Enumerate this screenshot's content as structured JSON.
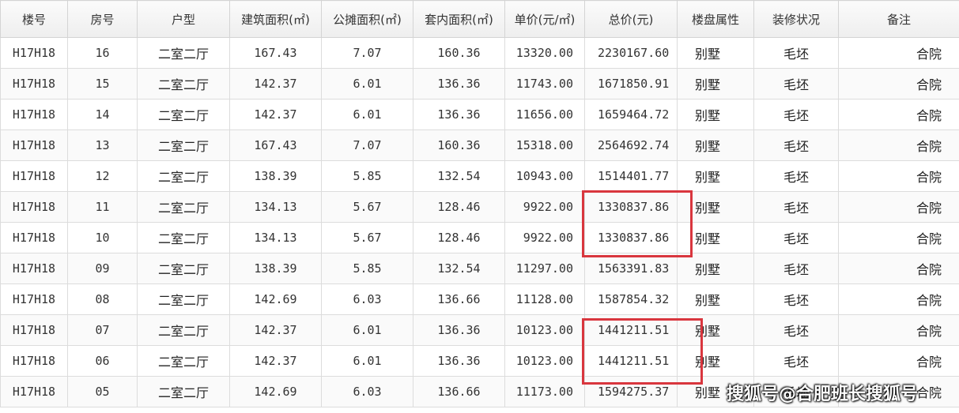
{
  "table": {
    "headers": [
      "楼号",
      "房号",
      "户型",
      "建筑面积(㎡)",
      "公摊面积(㎡)",
      "套内面积(㎡)",
      "单价(元/㎡)",
      "总价(元)",
      "楼盘属性",
      "装修状况",
      "备注"
    ],
    "rows": [
      {
        "building": "H17H18",
        "room": "16",
        "layout": "二室二厅",
        "gross_area": "167.43",
        "shared_area": "7.07",
        "inner_area": "160.36",
        "unit_price": "13320.00",
        "total_price": "2230167.60",
        "property_type": "别墅",
        "decoration": "毛坯",
        "note": "合院"
      },
      {
        "building": "H17H18",
        "room": "15",
        "layout": "二室二厅",
        "gross_area": "142.37",
        "shared_area": "6.01",
        "inner_area": "136.36",
        "unit_price": "11743.00",
        "total_price": "1671850.91",
        "property_type": "别墅",
        "decoration": "毛坯",
        "note": "合院"
      },
      {
        "building": "H17H18",
        "room": "14",
        "layout": "二室二厅",
        "gross_area": "142.37",
        "shared_area": "6.01",
        "inner_area": "136.36",
        "unit_price": "11656.00",
        "total_price": "1659464.72",
        "property_type": "别墅",
        "decoration": "毛坯",
        "note": "合院"
      },
      {
        "building": "H17H18",
        "room": "13",
        "layout": "二室二厅",
        "gross_area": "167.43",
        "shared_area": "7.07",
        "inner_area": "160.36",
        "unit_price": "15318.00",
        "total_price": "2564692.74",
        "property_type": "别墅",
        "decoration": "毛坯",
        "note": "合院"
      },
      {
        "building": "H17H18",
        "room": "12",
        "layout": "二室二厅",
        "gross_area": "138.39",
        "shared_area": "5.85",
        "inner_area": "132.54",
        "unit_price": "10943.00",
        "total_price": "1514401.77",
        "property_type": "别墅",
        "decoration": "毛坯",
        "note": "合院"
      },
      {
        "building": "H17H18",
        "room": "11",
        "layout": "二室二厅",
        "gross_area": "134.13",
        "shared_area": "5.67",
        "inner_area": "128.46",
        "unit_price": "9922.00",
        "total_price": "1330837.86",
        "property_type": "别墅",
        "decoration": "毛坯",
        "note": "合院"
      },
      {
        "building": "H17H18",
        "room": "10",
        "layout": "二室二厅",
        "gross_area": "134.13",
        "shared_area": "5.67",
        "inner_area": "128.46",
        "unit_price": "9922.00",
        "total_price": "1330837.86",
        "property_type": "别墅",
        "decoration": "毛坯",
        "note": "合院"
      },
      {
        "building": "H17H18",
        "room": "09",
        "layout": "二室二厅",
        "gross_area": "138.39",
        "shared_area": "5.85",
        "inner_area": "132.54",
        "unit_price": "11297.00",
        "total_price": "1563391.83",
        "property_type": "别墅",
        "decoration": "毛坯",
        "note": "合院"
      },
      {
        "building": "H17H18",
        "room": "08",
        "layout": "二室二厅",
        "gross_area": "142.69",
        "shared_area": "6.03",
        "inner_area": "136.66",
        "unit_price": "11128.00",
        "total_price": "1587854.32",
        "property_type": "别墅",
        "decoration": "毛坯",
        "note": "合院"
      },
      {
        "building": "H17H18",
        "room": "07",
        "layout": "二室二厅",
        "gross_area": "142.37",
        "shared_area": "6.01",
        "inner_area": "136.36",
        "unit_price": "10123.00",
        "total_price": "1441211.51",
        "property_type": "别墅",
        "decoration": "毛坯",
        "note": "合院"
      },
      {
        "building": "H17H18",
        "room": "06",
        "layout": "二室二厅",
        "gross_area": "142.37",
        "shared_area": "6.01",
        "inner_area": "136.36",
        "unit_price": "10123.00",
        "total_price": "1441211.51",
        "property_type": "别墅",
        "decoration": "毛坯",
        "note": "合院"
      },
      {
        "building": "H17H18",
        "room": "05",
        "layout": "二室二厅",
        "gross_area": "142.69",
        "shared_area": "6.03",
        "inner_area": "136.66",
        "unit_price": "11173.00",
        "total_price": "1594275.37",
        "property_type": "别墅",
        "decoration": "毛坯",
        "note": "合院"
      }
    ]
  },
  "highlight": {
    "color": "#d9363e",
    "column": "总价(元)",
    "groups": [
      [
        "11",
        "10"
      ],
      [
        "07",
        "06"
      ]
    ]
  },
  "watermark": {
    "text": "搜狐号@合肥班长搜狐号"
  }
}
